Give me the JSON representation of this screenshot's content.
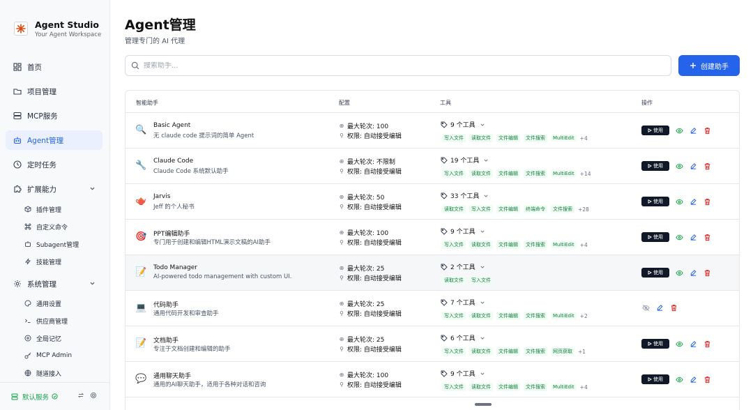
{
  "brand": {
    "title": "Agent Studio",
    "subtitle": "Your Agent Workspace"
  },
  "nav": [
    {
      "label": "首页",
      "icon": "dashboard-icon"
    },
    {
      "label": "项目管理",
      "icon": "folder-icon"
    },
    {
      "label": "MCP服务",
      "icon": "server-icon"
    },
    {
      "label": "Agent管理",
      "icon": "bot-icon",
      "active": true
    },
    {
      "label": "定时任务",
      "icon": "clock-icon"
    },
    {
      "label": "扩展能力",
      "icon": "puzzle-icon"
    },
    {
      "label": "系统管理",
      "icon": "gear-icon"
    }
  ],
  "extensions": [
    {
      "label": "插件管理",
      "icon": "package-icon"
    },
    {
      "label": "自定义命令",
      "icon": "command-icon"
    },
    {
      "label": "Subagent管理",
      "icon": "subagent-icon"
    },
    {
      "label": "技能管理",
      "icon": "bolt-icon"
    }
  ],
  "system": [
    {
      "label": "通用设置",
      "icon": "palette-icon"
    },
    {
      "label": "供应商管理",
      "icon": "terminal-icon"
    },
    {
      "label": "全局记忆",
      "icon": "memory-icon"
    },
    {
      "label": "MCP Admin",
      "icon": "key-icon"
    },
    {
      "label": "隧道接入",
      "icon": "globe-icon"
    }
  ],
  "footer": {
    "status": "默认服务"
  },
  "header": {
    "title": "Agent管理",
    "subtitle": "管理专门的 AI 代理"
  },
  "search": {
    "placeholder": "搜索助手..."
  },
  "create_button": "创建助手",
  "table": {
    "headers": [
      "智能助手",
      "配置",
      "工具",
      "操作"
    ],
    "use_label": "使用",
    "rows": [
      {
        "icon": "🔍",
        "name": "Basic Agent",
        "desc": "无 claude code 提示词的简单 Agent",
        "turns": "最大轮次: 100",
        "perm": "权限: 自动接受编辑",
        "tools": "9 个工具",
        "tags": [
          "写入文件",
          "读取文件",
          "文件编辑",
          "文件搜索",
          "MultiEdit"
        ],
        "more": "+4",
        "has_use": true
      },
      {
        "icon": "🔧",
        "name": "Claude Code",
        "desc": "Claude Code 系统默认助手",
        "turns": "最大轮次: 不限制",
        "perm": "权限: 自动接受编辑",
        "tools": "19 个工具",
        "tags": [
          "写入文件",
          "读取文件",
          "文件编辑",
          "文件搜索",
          "MultiEdit"
        ],
        "more": "+14",
        "has_use": true
      },
      {
        "icon": "🫖",
        "name": "Jarvis",
        "desc": "Jeff 的个人秘书",
        "turns": "最大轮次: 50",
        "perm": "权限: 自动接受编辑",
        "tools": "33 个工具",
        "tags": [
          "读取文件",
          "写入文件",
          "文件编辑",
          "终端命令",
          "文件搜索"
        ],
        "more": "+28",
        "has_use": true
      },
      {
        "icon": "🎯",
        "name": "PPT编辑助手",
        "desc": "专门用于创建和编辑HTML演示文稿的AI助手",
        "turns": "最大轮次: 100",
        "perm": "权限: 自动接受编辑",
        "tools": "9 个工具",
        "tags": [
          "写入文件",
          "读取文件",
          "文件编辑",
          "文件搜索",
          "MultiEdit"
        ],
        "more": "+4",
        "has_use": true
      },
      {
        "icon": "📝",
        "name": "Todo Manager",
        "desc": "AI-powered todo management with custom UI.",
        "turns": "最大轮次: 25",
        "perm": "权限: 自动接受编辑",
        "tools": "2 个工具",
        "tags": [
          "读取文件",
          "写入文件"
        ],
        "more": "",
        "has_use": true,
        "highlight": true
      },
      {
        "icon": "💻",
        "name": "代码助手",
        "desc": "通用代码开发和审查助手",
        "turns": "最大轮次: 25",
        "perm": "权限: 自动接受编辑",
        "tools": "7 个工具",
        "tags": [
          "写入文件",
          "读取文件",
          "文件编辑",
          "文件搜索",
          "MultiEdit"
        ],
        "more": "+2",
        "has_use": false
      },
      {
        "icon": "📝",
        "name": "文档助手",
        "desc": "专注于文档创建和编辑的助手",
        "turns": "最大轮次: 25",
        "perm": "权限: 自动接受编辑",
        "tools": "6 个工具",
        "tags": [
          "写入文件",
          "读取文件",
          "文件编辑",
          "文件搜索",
          "网页获取"
        ],
        "more": "+1",
        "has_use": true
      },
      {
        "icon": "💬",
        "name": "通用聊天助手",
        "desc": "通用的AI聊天助手，适用于各种对话和咨询",
        "turns": "最大轮次: 100",
        "perm": "权限: 自动接受编辑",
        "tools": "9 个工具",
        "tags": [
          "写入文件",
          "读取文件",
          "文件编辑",
          "文件搜索",
          "MultiEdit"
        ],
        "more": "+4",
        "has_use": true
      }
    ]
  }
}
